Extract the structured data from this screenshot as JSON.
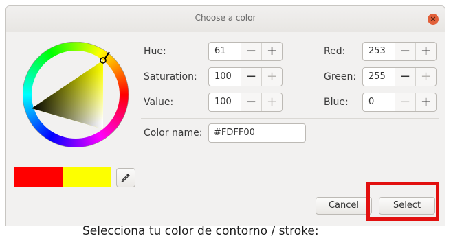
{
  "window": {
    "title": "Choose a color",
    "close_symbol": "×"
  },
  "colors": {
    "current": "#FDFF00",
    "previous": "#FF0000",
    "accent": "#E2603A",
    "highlight_border": "#E2100F"
  },
  "fields": {
    "hue": {
      "label": "Hue:",
      "value": "61"
    },
    "saturation": {
      "label": "Saturation:",
      "value": "100"
    },
    "value": {
      "label": "Value:",
      "value": "100"
    },
    "red": {
      "label": "Red:",
      "value": "253"
    },
    "green": {
      "label": "Green:",
      "value": "255"
    },
    "blue": {
      "label": "Blue:",
      "value": "0"
    },
    "color_name": {
      "label": "Color name:",
      "value": "#FDFF00"
    }
  },
  "spin": {
    "minus": "−",
    "plus": "+"
  },
  "buttons": {
    "cancel": "Cancel",
    "select": "Select"
  },
  "caption": "Selecciona tu color de contorno / stroke:",
  "icons": {
    "eyedropper": "eyedropper-icon",
    "close": "close-icon"
  }
}
